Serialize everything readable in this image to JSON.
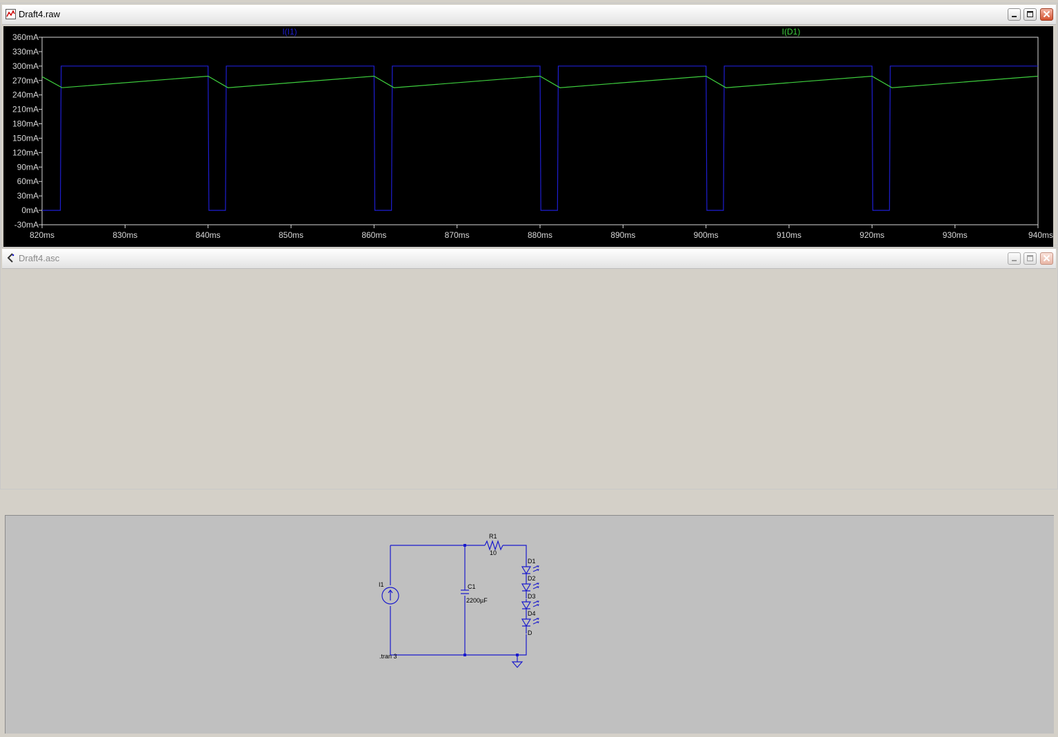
{
  "waveform_window": {
    "title": "Draft4.raw",
    "icon": "waveform-icon",
    "controls": [
      "minimize-icon",
      "maximize-icon",
      "close-icon"
    ]
  },
  "schematic_window": {
    "title": "Draft4.asc",
    "icon": "schematic-icon",
    "controls": [
      "minimize-icon",
      "maximize-icon",
      "close-icon"
    ]
  },
  "chart_data": {
    "type": "line",
    "xlim": [
      820,
      940
    ],
    "ylim": [
      -30,
      360
    ],
    "x_unit": "ms",
    "y_unit": "mA",
    "x_ticks": [
      "820ms",
      "830ms",
      "840ms",
      "850ms",
      "860ms",
      "870ms",
      "880ms",
      "890ms",
      "900ms",
      "910ms",
      "920ms",
      "930ms",
      "940ms"
    ],
    "y_ticks": [
      "360mA",
      "330mA",
      "300mA",
      "270mA",
      "240mA",
      "210mA",
      "180mA",
      "150mA",
      "120mA",
      "90mA",
      "60mA",
      "30mA",
      "0mA",
      "-30mA"
    ],
    "grid": false,
    "background": "#000000",
    "series": [
      {
        "name": "I(I1)",
        "color": "#1e1ed2",
        "x": [
          820,
          822.2,
          822.3,
          840.0,
          840.1,
          842.1,
          842.2,
          860.0,
          860.1,
          862.1,
          862.2,
          880.0,
          880.1,
          882.1,
          882.2,
          900.0,
          900.1,
          902.1,
          902.2,
          920.0,
          920.1,
          922.1,
          922.2,
          940
        ],
        "y": [
          0,
          0,
          300,
          300,
          0,
          0,
          300,
          300,
          0,
          0,
          300,
          300,
          0,
          0,
          300,
          300,
          0,
          0,
          300,
          300,
          0,
          0,
          300,
          300
        ]
      },
      {
        "name": "I(D1)",
        "color": "#3ecf3e",
        "x": [
          820,
          822.4,
          840.0,
          842.4,
          860.0,
          862.4,
          880.0,
          882.4,
          900.0,
          902.4,
          920.0,
          922.4,
          940
        ],
        "y": [
          278,
          255,
          279,
          255,
          279,
          255,
          279,
          255,
          279,
          255,
          279,
          255,
          279
        ]
      }
    ]
  },
  "schematic": {
    "wire_color": "#1a1acc",
    "source_label": "I1",
    "cap_ref": "C1",
    "cap_value": "2200µF",
    "res_ref": "R1",
    "res_value": "10",
    "diode_labels": [
      "D1",
      "D2",
      "D3",
      "D4",
      "D"
    ],
    "directive": ".tran 3"
  }
}
